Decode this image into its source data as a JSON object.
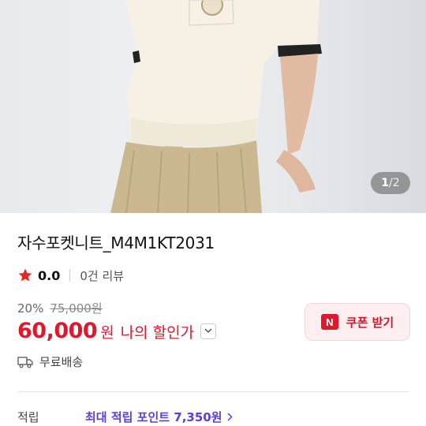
{
  "gallery": {
    "current": "1",
    "separator": "/",
    "total": "2"
  },
  "product": {
    "title": "자수포켓니트_M4M1KT2031",
    "rating": "0.0",
    "reviews": "0건 리뷰",
    "discount_rate": "20%",
    "original_price": "75,000원",
    "sale_price": "60,000",
    "currency": "원",
    "my_discount_label": "나의 할인가",
    "shipping": "무료배송"
  },
  "coupon": {
    "badge": "N",
    "label": "쿠폰 받기"
  },
  "points": {
    "label": "적립",
    "value": "최대 적립 포인트 7,350원"
  },
  "colors": {
    "sale_red": "#e0182d",
    "star": "#e8251f",
    "point_purple": "#5c3fd6",
    "coupon_bg": "#fdeef0"
  },
  "icons": [
    "star-icon",
    "chevron-down-icon",
    "naver-n-icon",
    "truck-icon",
    "chevron-right-icon"
  ]
}
